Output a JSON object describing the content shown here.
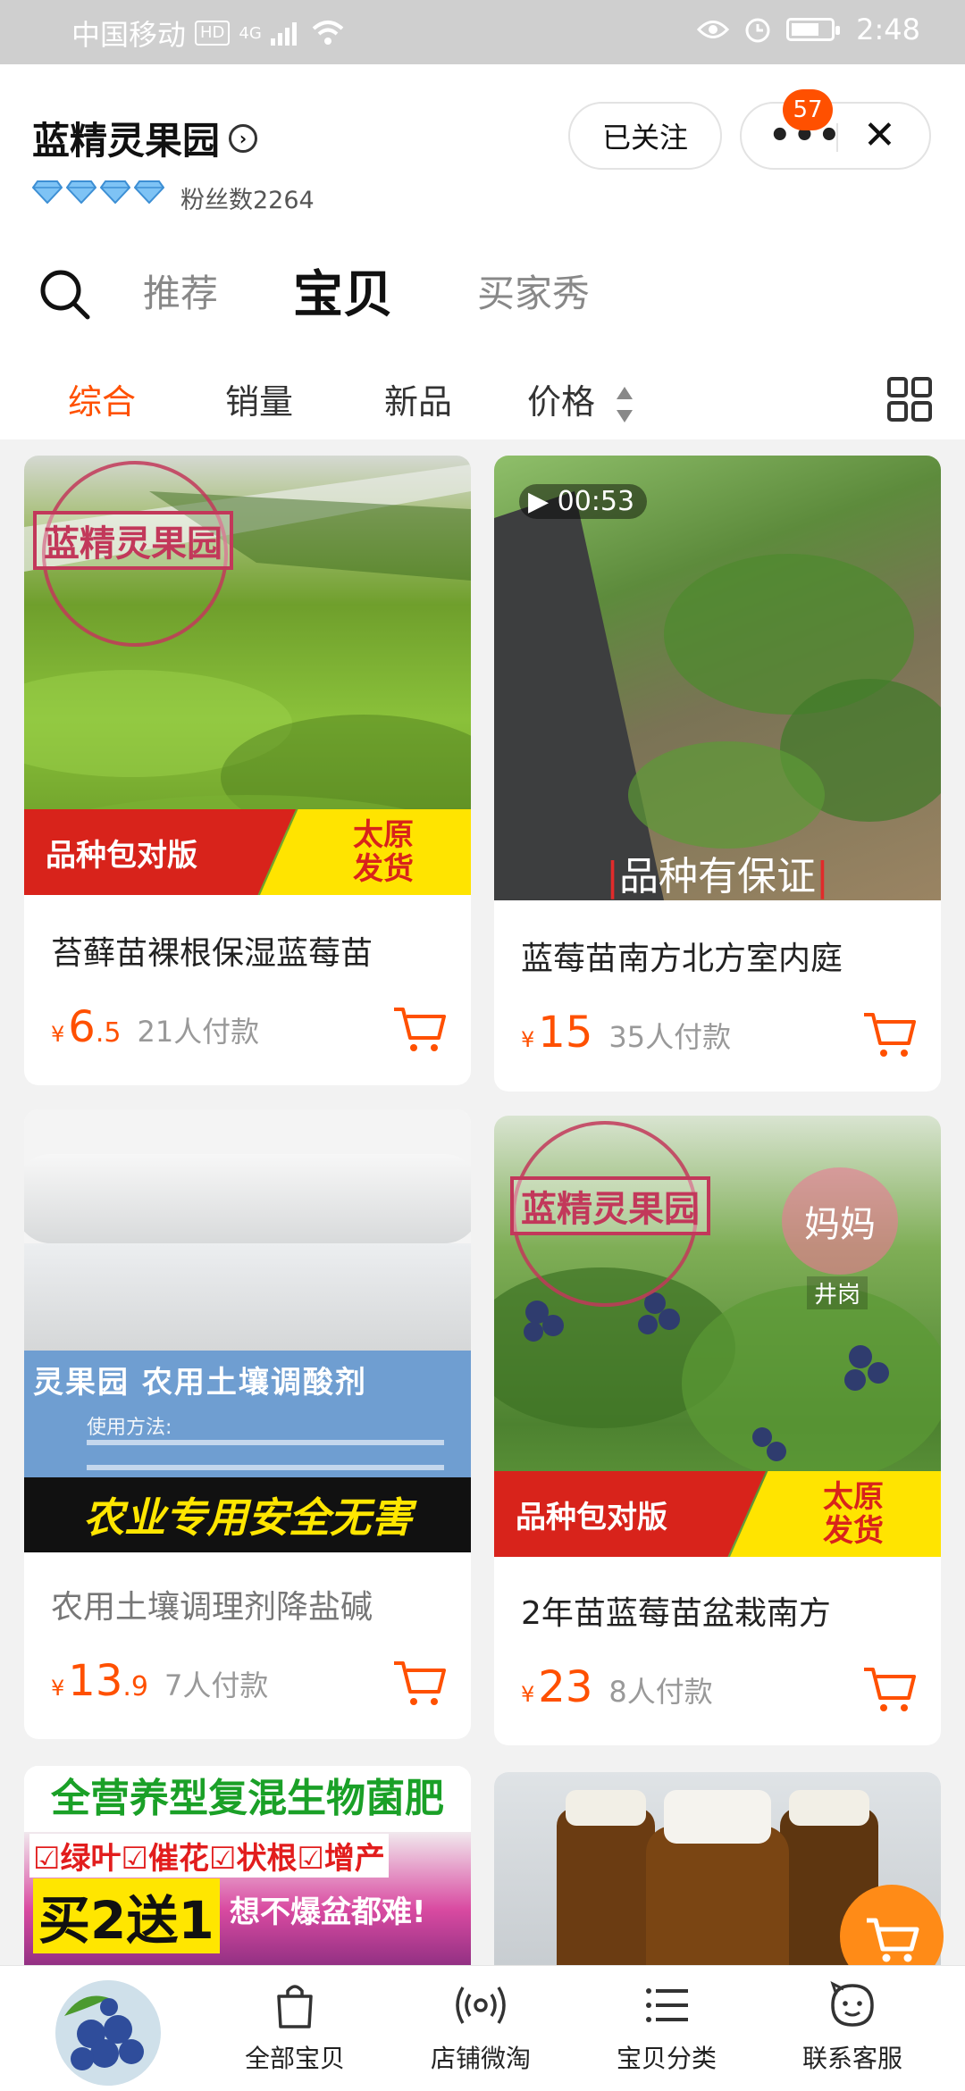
{
  "status_bar": {
    "carrier": "中国移动",
    "network_badge": "HD",
    "network_type": "4G",
    "time": "2:48",
    "icons": [
      "signal-icon",
      "wifi-icon",
      "eye-icon",
      "alarm-icon",
      "battery-icon"
    ]
  },
  "shop": {
    "name": "蓝精灵果园",
    "fans": "粉丝数2264",
    "diamond_count": 4,
    "follow_label": "已关注",
    "notification_count": "57"
  },
  "tabs": [
    "推荐",
    "宝贝",
    "买家秀"
  ],
  "active_tab": "宝贝",
  "sort": {
    "items": [
      "综合",
      "销量",
      "新品",
      "价格"
    ],
    "active": "综合"
  },
  "products": [
    {
      "title": "苔藓苗裸根保湿蓝莓苗",
      "price_currency": "¥",
      "price_int": "6",
      "price_dec": ".5",
      "sold": "21人付款",
      "image_stamp": "蓝精灵果园",
      "banner_left": "品种包对版",
      "banner_right_line1": "太原",
      "banner_right_line2": "发货"
    },
    {
      "title": "蓝莓苗南方北方室内庭",
      "price_currency": "¥",
      "price_int": "15",
      "price_dec": "",
      "sold": "35人付款",
      "video_duration": "00:53",
      "overlay": "品种有保证"
    },
    {
      "title": "农用土壤调理剂降盐碱",
      "price_currency": "¥",
      "price_int": "13",
      "price_dec": ".9",
      "sold": "7人付款",
      "label_text": "灵果园  农用土壤调酸剂",
      "usage_title": "使用方法:",
      "banner": "农业专用安全无害"
    },
    {
      "title": "2年苗蓝莓苗盆栽南方",
      "price_currency": "¥",
      "price_int": "23",
      "price_dec": "",
      "sold": "8人付款",
      "image_stamp": "蓝精灵果园",
      "watermark": "妈妈",
      "watermark_sub": "井岗",
      "banner_left": "品种包对版",
      "banner_right_line1": "太原",
      "banner_right_line2": "发货"
    },
    {
      "image_title": "全营养型复混生物菌肥",
      "image_tags": "☑绿叶☑催花☑状根☑增产",
      "image_promo": "买2送1",
      "image_slogan": "想不爆盆都难!"
    },
    {
      "image_alt": "bottles"
    }
  ],
  "bottom_nav": [
    {
      "label": "全部宝贝",
      "icon": "shopping-bag-icon"
    },
    {
      "label": "店铺微淘",
      "icon": "broadcast-icon"
    },
    {
      "label": "宝贝分类",
      "icon": "list-icon"
    },
    {
      "label": "联系客服",
      "icon": "customer-service-icon"
    }
  ],
  "colors": {
    "accent": "#ff5000",
    "status_bar": "#cfcfcf",
    "price": "#ff5000",
    "float_cart": "#ff8b17"
  }
}
